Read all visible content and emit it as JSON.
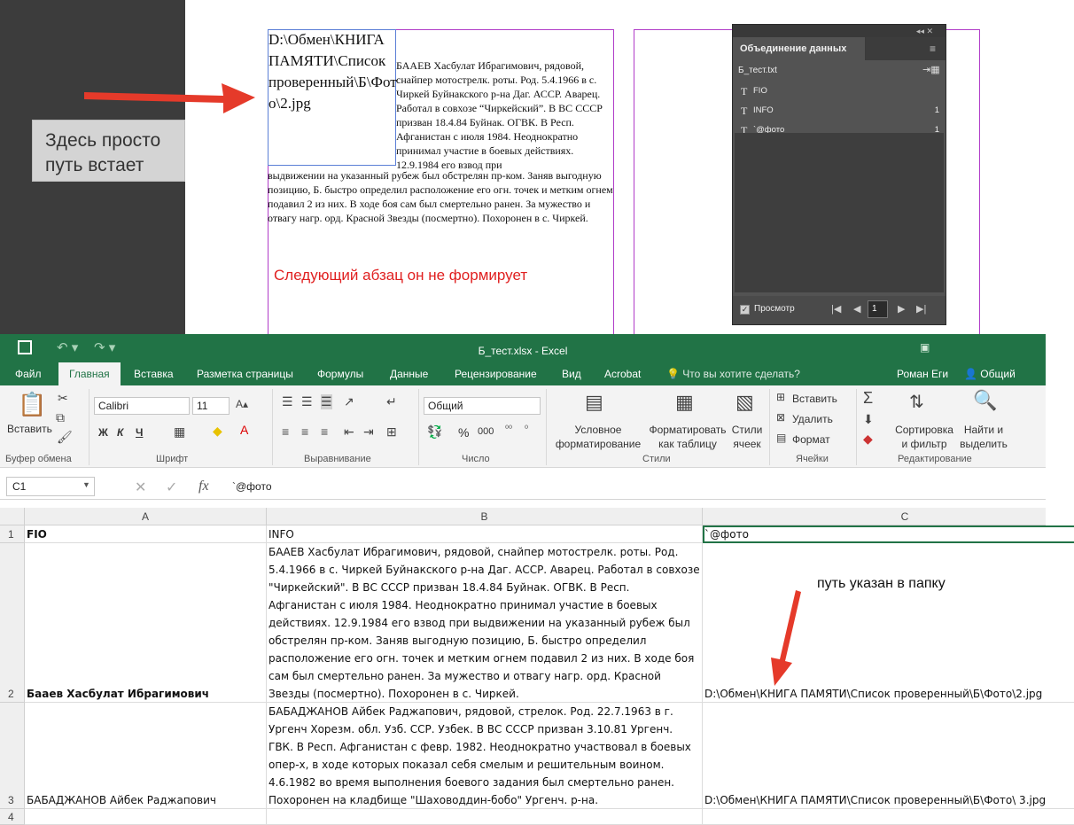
{
  "callout": {
    "text": "Здесь просто\nпуть встает"
  },
  "indesign": {
    "image_path": "D:\\Обмен\\КНИГА ПАМЯТИ\\Список проверенный\\Б\\Фото\\2.jpg",
    "para_part1": "БААЕВ Хасбулат Ибрагимович, рядовой, снайпер мотострелк. роты. Род. 5.4.1966 в с. Чиркей Буйнакского р-на Даг. АССР. Аварец. Работал в совхозе “Чиркейский”. В ВС СССР призван 18.4.84 Буйнак. ОГВК. В Респ. Афганистан с июля 1984. Неоднократно принимал участие в боевых действиях. 12.9.1984 его взвод при",
    "para_part2": "выдвижении на указанный рубеж был обстрелян пр-ком. Заняв выгодную позицию, Б. быстро определил расположение его огн. точек и метким огнем подавил 2 из них. В ходе боя сам был смертельно ранен. За мужество и отвагу нагр. орд. Красной Звезды (посмертно). Похоронен в с. Чиркей.",
    "red_note": "Следующий абзац он не формирует"
  },
  "data_merge": {
    "title": "Объединение данных",
    "source": "Б_тест.txt",
    "fields": [
      {
        "name": "FIO",
        "count": ""
      },
      {
        "name": "INFO",
        "count": "1"
      },
      {
        "name": "`@фото",
        "count": "1"
      }
    ],
    "preview_label": "Просмотр",
    "page": "1"
  },
  "excel": {
    "title": "Б_тест.xlsx - Excel",
    "tabs": [
      "Файл",
      "Главная",
      "Вставка",
      "Разметка страницы",
      "Формулы",
      "Данные",
      "Рецензирование",
      "Вид",
      "Acrobat",
      "Что вы хотите сделать?",
      "Роман Еги",
      "Общий досту"
    ],
    "ribbon": {
      "paste": "Вставить",
      "clipboard": "Буфер обмена",
      "font_name": "Calibri",
      "font_size": "11",
      "font_group": "Шрифт",
      "bold": "Ж",
      "italic": "К",
      "underline": "Ч",
      "align_group": "Выравнивание",
      "number_format": "Общий",
      "number_group": "Число",
      "percent": "%",
      "thousands": "000",
      "cond_format": "Условное форматирование",
      "format_table": "Форматировать как таблицу",
      "cell_styles": "Стили ячеек",
      "styles_group": "Стили",
      "insert": "Вставить",
      "delete": "Удалить",
      "format": "Формат",
      "cells_group": "Ячейки",
      "sort": "Сортировка и фильтр",
      "find": "Найти и выделить",
      "edit_group": "Редактирование"
    },
    "name_box": "C1",
    "formula": "`@фото",
    "columns": [
      "A",
      "B",
      "C"
    ],
    "rows": [
      {
        "num": "1",
        "a": "FIO",
        "b": "INFO",
        "c": "`@фото"
      },
      {
        "num": "2",
        "a": "Бааев Хасбулат Ибрагимович",
        "b": "БААЕВ Хасбулат Ибрагимович, рядовой, снайпер мотострелк. роты. Род. 5.4.1966 в с. Чиркей Буйнакского р-на Даг. АССР. Аварец. Работал в совхозе \"Чиркейский\". В ВС СССР призван 18.4.84 Буйнак. ОГВК. В Респ. Афганистан с июля 1984. Неоднократно принимал участие в боевых действиях. 12.9.1984 его взвод при выдвижении на указанный рубеж был обстрелян пр-ком. Заняв выгодную позицию, Б. быстро определил расположение его огн. точек и метким огнем подавил 2 из них. В ходе боя сам был смертельно ранен. За мужество и отвагу нагр. орд. Красной Звезды (посмертно). Похоронен в с. Чиркей.",
        "c": "D:\\Обмен\\КНИГА ПАМЯТИ\\Список проверенный\\Б\\Фото\\2.jpg"
      },
      {
        "num": "3",
        "a": "БАБАДЖАНОВ Айбек Раджапович",
        "b": "БАБАДЖАНОВ Айбек Раджапович, рядовой, стрелок. Род. 22.7.1963 в г. Ургенч Хорезм. обл. Узб. ССР. Узбек. В ВС СССР призван 3.10.81 Ургенч. ГВК. В Респ. Афганистан с февр. 1982. Неоднократно участвовал в боевых опер-х, в ходе которых показал себя смелым и решительным воином. 4.6.1982 во время выполнения боевого задания был смертельно ранен. Похоронен на кладбище \"Шаховоддин-бобо\" Ургенч. р-на.",
        "c": "D:\\Обмен\\КНИГА ПАМЯТИ\\Список проверенный\\Б\\Фото\\ 3.jpg"
      },
      {
        "num": "4",
        "a": "",
        "b": "",
        "c": ""
      }
    ],
    "annotation": "путь указан в папку"
  },
  "colors": {
    "excel_green": "#217346",
    "arrow_red": "#e53a2a"
  }
}
